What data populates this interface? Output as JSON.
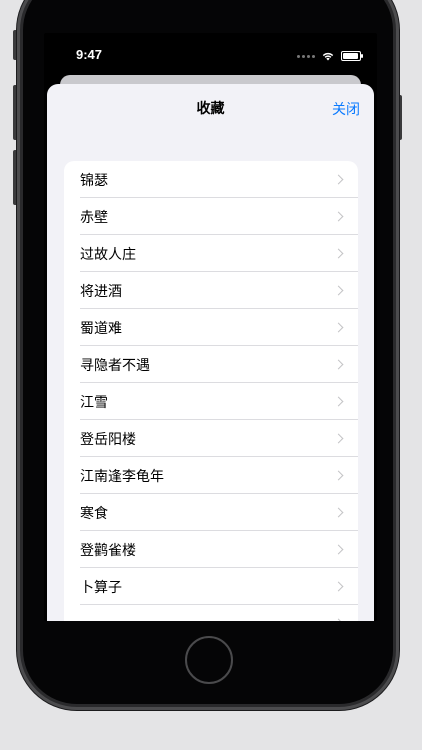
{
  "status_bar": {
    "time": "9:47"
  },
  "sheet": {
    "title": "收藏",
    "close_label": "关闭",
    "items": [
      {
        "label": "锦瑟"
      },
      {
        "label": "赤壁"
      },
      {
        "label": "过故人庄"
      },
      {
        "label": "将进酒"
      },
      {
        "label": "蜀道难"
      },
      {
        "label": "寻隐者不遇"
      },
      {
        "label": "江雪"
      },
      {
        "label": "登岳阳楼"
      },
      {
        "label": "江南逢李龟年"
      },
      {
        "label": "寒食"
      },
      {
        "label": "登鹳雀楼"
      },
      {
        "label": "卜算子"
      },
      {
        "label": ""
      }
    ]
  },
  "colors": {
    "accent": "#0a7aff",
    "sheet_background": "#f2f2f7",
    "page_background": "#e4e4e6"
  }
}
